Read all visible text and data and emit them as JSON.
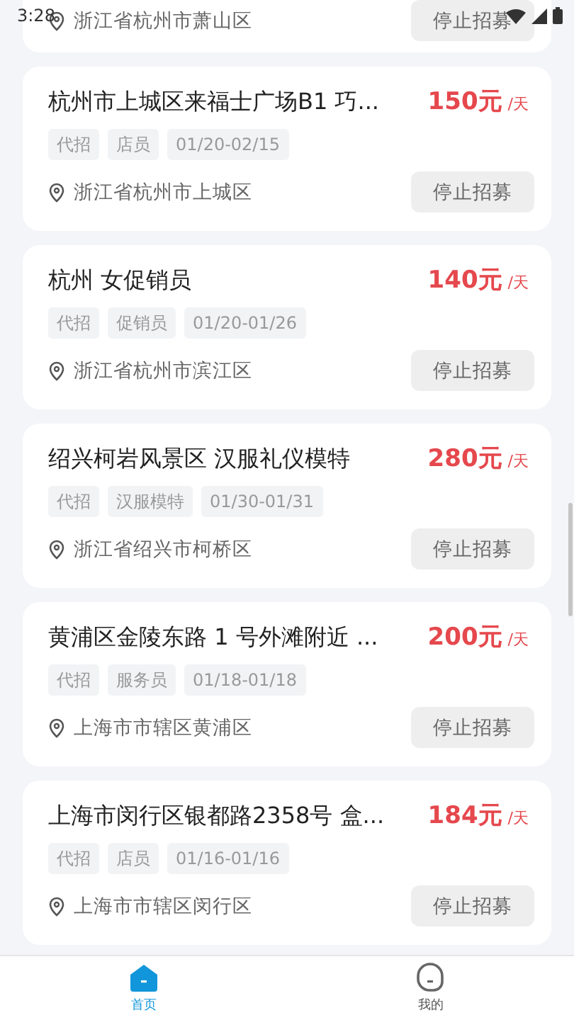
{
  "status_bar": {
    "time": "3:28"
  },
  "partial_card": {
    "location": "浙江省杭州市萧山区",
    "button": "停止招募"
  },
  "jobs": [
    {
      "title": "杭州市上城区来福士广场B1 巧...",
      "price": "150元",
      "unit": "/天",
      "tags": [
        "代招",
        "店员",
        "01/20-02/15"
      ],
      "location": "浙江省杭州市上城区",
      "button": "停止招募"
    },
    {
      "title": "杭州 女促销员",
      "price": "140元",
      "unit": "/天",
      "tags": [
        "代招",
        "促销员",
        "01/20-01/26"
      ],
      "location": "浙江省杭州市滨江区",
      "button": "停止招募"
    },
    {
      "title": "绍兴柯岩风景区 汉服礼仪模特",
      "price": "280元",
      "unit": "/天",
      "tags": [
        "代招",
        "汉服模特",
        "01/30-01/31"
      ],
      "location": "浙江省绍兴市柯桥区",
      "button": "停止招募"
    },
    {
      "title": "黄浦区金陵东路 1 号外滩附近 ...",
      "price": "200元",
      "unit": "/天",
      "tags": [
        "代招",
        "服务员",
        "01/18-01/18"
      ],
      "location": "上海市市辖区黄浦区",
      "button": "停止招募"
    },
    {
      "title": "上海市闵行区银都路2358号 盒...",
      "price": "184元",
      "unit": "/天",
      "tags": [
        "代招",
        "店员",
        "01/16-01/16"
      ],
      "location": "上海市市辖区闵行区",
      "button": "停止招募"
    }
  ],
  "tabbar": [
    {
      "label": "首页",
      "kind": "home",
      "selected": true
    },
    {
      "label": "我的",
      "kind": "profile",
      "selected": false
    }
  ]
}
